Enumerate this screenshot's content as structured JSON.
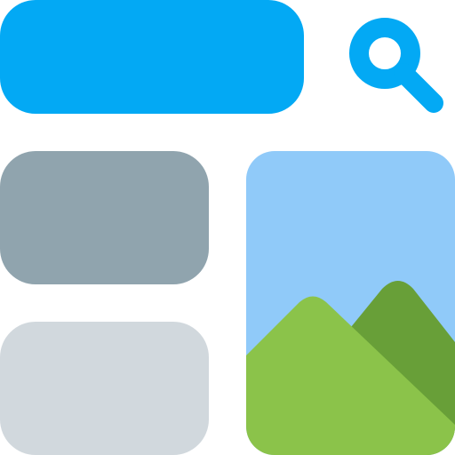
{
  "colors": {
    "accent": "#03A9F4",
    "card_dark": "#90A4AE",
    "card_light": "#D1D8DD",
    "sky": "#90CAF9",
    "mountain_front": "#8BC34A",
    "mountain_back": "#689F38"
  },
  "icons": {
    "search": "magnifier-icon",
    "image": "landscape-image-icon"
  }
}
